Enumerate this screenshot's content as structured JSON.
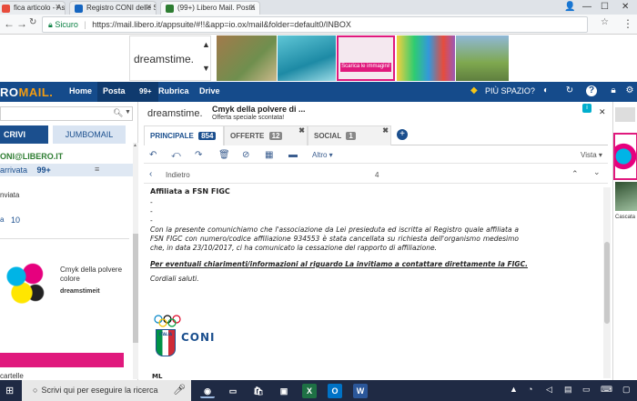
{
  "browser": {
    "tabs": [
      {
        "label": "fica articolo - Asso",
        "active": false,
        "color": "#e74c3c"
      },
      {
        "label": "Registro CONI delle Soc",
        "active": false,
        "color": "#1565c0"
      },
      {
        "label": "(99+) Libero Mail. Posta",
        "active": true,
        "color": "#2e7d32"
      }
    ],
    "window_controls": [
      "user",
      "minimize",
      "maximize",
      "close"
    ],
    "secure_label": "Sicuro",
    "url": "https://mail.libero.it/appsuite/#!!&app=io.ox/mail&folder=default0/INBOX"
  },
  "ads_top": {
    "brand": "dreamstime.",
    "banner_text": "Scarica le immagini!"
  },
  "app": {
    "logo_prefix": "RO",
    "logo_suffix": "MAIL.",
    "nav": [
      {
        "label": "Home"
      },
      {
        "label": "Posta",
        "badge": "99+",
        "active": true
      },
      {
        "label": "Rubrica"
      },
      {
        "label": "Drive"
      }
    ],
    "promo": "PIÙ SPAZIO?",
    "header_icons": [
      "help-icon",
      "refresh-icon",
      "question-icon",
      "lock-icon",
      "settings-icon"
    ]
  },
  "left": {
    "search_placeholder": "",
    "scrivi_label": "CRIVI",
    "jumbomail_label": "JUMBOMAIL",
    "email": "ONI@LIBERO.IT",
    "inbox_label": "arrivata",
    "inbox_count": "99+",
    "folder1": "nviata",
    "folder2_count": "10",
    "ad_title": "Cmyk della polvere colore",
    "ad_brand": "dreamstimeit",
    "folder_last": "cartelle"
  },
  "mid_ad": {
    "brand": "dreamstime.",
    "title": "Cmyk della polvere di ...",
    "subtitle": "Offerta speciale scontata!"
  },
  "mail_tabs": [
    {
      "label": "PRINCIPALE",
      "count": "854",
      "active": true,
      "count_color": "#1b4f8e"
    },
    {
      "label": "OFFERTE",
      "count": "12",
      "active": false,
      "count_color": "#888888"
    },
    {
      "label": "SOCIAL",
      "count": "1",
      "active": false,
      "count_color": "#888888"
    }
  ],
  "toolbar": {
    "altro_label": "Altro",
    "vista_label": "Vista"
  },
  "subbar": {
    "back_label": "Indietro",
    "count": "4"
  },
  "message": {
    "heading": "Affiliata a FSN  FIGC",
    "bullets": [
      "-",
      "-",
      "-"
    ],
    "para1": "Con la presente comunichiamo che l'associazione da Lei presieduta ed iscritta al Registro quale affiliata a FSN FIGC con numero/codice affiliazione 934553    è stata cancellata su richiesta dell'organismo medesimo che, in data 23/10/2017, ci ha comunicato la cessazione del rapporto di affiliazione.",
    "para2": "Per eventuali chiarimenti/informazioni al riguardo La invitiamo a contattare direttamente la FIGC.",
    "para3": "Cordiali saluti.",
    "logo_label": "CONI",
    "logo_country": "ITALIA",
    "footer_text": "ML"
  },
  "right": {
    "caption": "Cascata"
  },
  "taskbar": {
    "search_label": "Scrivi qui per eseguire la ricerca",
    "tray_time": ""
  }
}
